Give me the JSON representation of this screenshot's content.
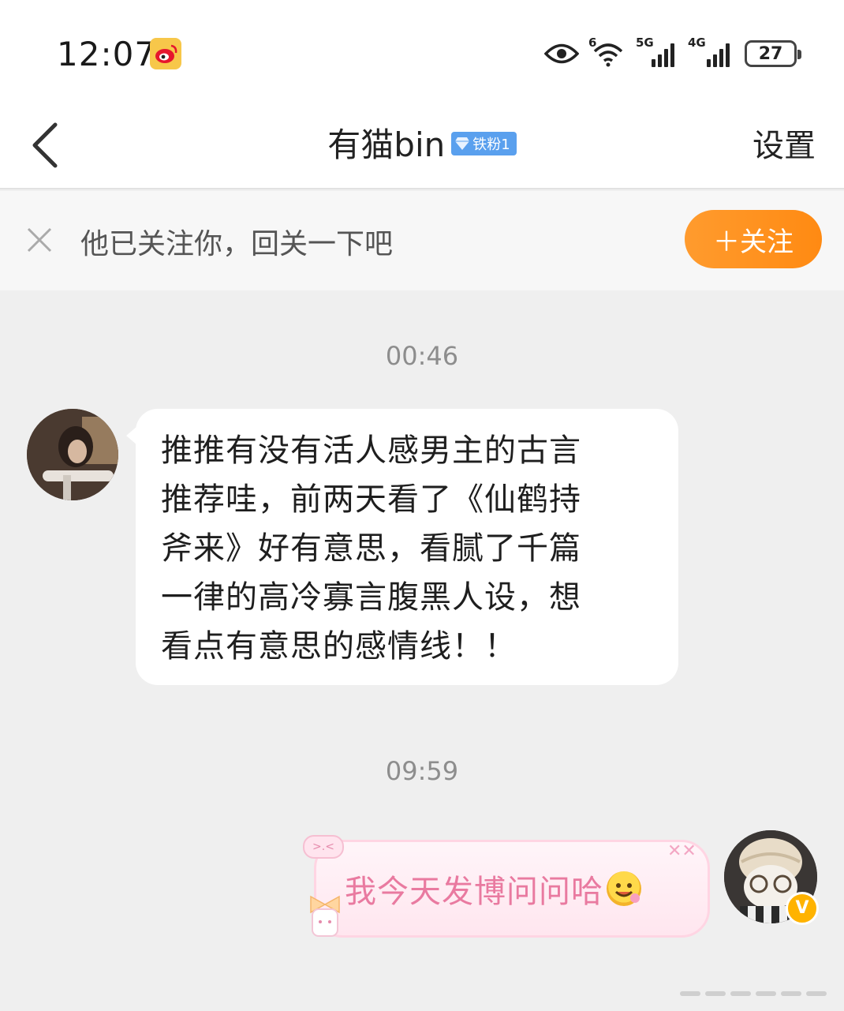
{
  "status_bar": {
    "time": "12:07",
    "wifi_label": "6",
    "signal_1_label": "5G",
    "signal_2_label": "4G",
    "battery": "27"
  },
  "header": {
    "back_icon": "chevron-left-icon",
    "title": "有猫bin",
    "fan_badge": "铁粉1",
    "settings_label": "设置"
  },
  "follow_banner": {
    "text": "他已关注你，回关一下吧",
    "button_label": "＋关注",
    "button_color": "#ff9224"
  },
  "messages": [
    {
      "timestamp": "00:46",
      "side": "left",
      "lines": [
        "推推有没有活人感男主的古言",
        "推荐哇，前两天看了《仙鹤持",
        "斧来》好有意思，看腻了千篇",
        "一律的高冷寡言腹黑人设，想",
        "看点有意思的感情线！！"
      ]
    },
    {
      "timestamp": "09:59",
      "side": "right",
      "text": "我今天发博问问哈",
      "bubble_decoration_text": ">.<",
      "accent_color": "#e97aa0"
    }
  ],
  "verified_badge": "V"
}
